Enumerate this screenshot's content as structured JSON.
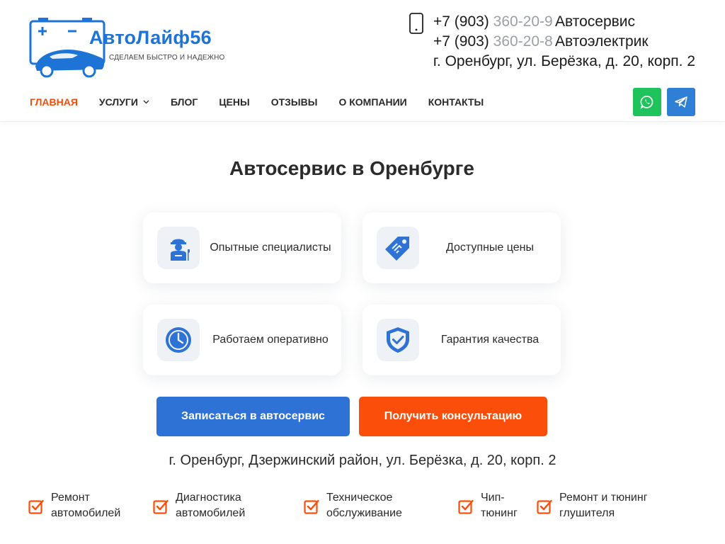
{
  "header": {
    "logo": {
      "title": "АвтоЛайф56",
      "subtitle": "СДЕЛАЕМ БЫСТРО И НАДЕЖНО"
    },
    "phones": [
      {
        "visible": "+7 (903)",
        "faded": " 360-20-9",
        "role": "Автосервис"
      },
      {
        "visible": "+7 (903)",
        "faded": " 360-20-8",
        "role": "Автоэлектрик"
      }
    ],
    "address": "г. Оренбург, ул. Берёзка, д. 20, корп. 2",
    "nav": [
      {
        "label": "Главная",
        "active": true
      },
      {
        "label": "Услуги",
        "has_dropdown": true
      },
      {
        "label": "Блог"
      },
      {
        "label": "Цены"
      },
      {
        "label": "Отзывы"
      },
      {
        "label": "О компании"
      },
      {
        "label": "Контакты"
      }
    ],
    "social": [
      {
        "icon": "whatsapp-icon",
        "color": "#1ec35b"
      },
      {
        "icon": "telegram-icon",
        "color": "#2f7fd6"
      }
    ]
  },
  "main": {
    "title": "Автосервис в Оренбурге",
    "features": [
      {
        "icon": "mechanic-icon",
        "label": "Опытные специалисты"
      },
      {
        "icon": "price-tag-icon",
        "label": "Доступные цены"
      },
      {
        "icon": "clock-icon",
        "label": "Работаем оперативно"
      },
      {
        "icon": "shield-check-icon",
        "label": "Гарантия качества"
      }
    ],
    "buttons": {
      "signup": "Записаться в автосервис",
      "consult": "Получить консультацию"
    },
    "address": "г. Оренбург, Дзержинский район, ул. Берёзка, д. 20, корп. 2",
    "services": [
      "Ремонт автомобилей",
      "Диагностика автомобилей",
      "Техническое обслуживание",
      "Чип-тюнинг",
      "Ремонт и тюнинг глушителя"
    ]
  },
  "colors": {
    "accent_orange": "#fb4e0b",
    "accent_blue": "#2f72d6",
    "logo_blue": "#1e74d6"
  }
}
